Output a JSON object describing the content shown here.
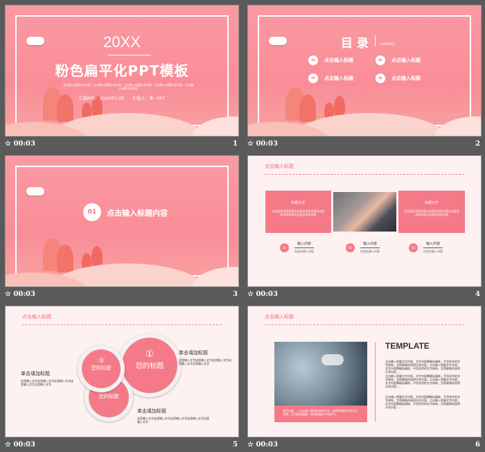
{
  "timing": "00:03",
  "star_icon": "star-outline-icon",
  "slides": [
    {
      "number": "1",
      "year": "20XX",
      "title": "粉色扁平化PPT模板",
      "subtitle": "点击输入标题文本内容，点击输入标题文本内容，点击输入标题文本内容，点击输入标题文本内容，点击输入标题文本内容",
      "meta": "汇报时间：20XX年12月　　汇报人：第一PPT"
    },
    {
      "number": "2",
      "title": "目 录",
      "title_en": "CONTENTS",
      "items": [
        {
          "num": "01",
          "label": "点击输入标题"
        },
        {
          "num": "02",
          "label": "点击输入标题"
        },
        {
          "num": "03",
          "label": "点击输入标题"
        },
        {
          "num": "04",
          "label": "点击输入标题"
        }
      ]
    },
    {
      "number": "3",
      "num": "01",
      "title": "点击输入标题内容"
    },
    {
      "number": "4",
      "header": "点击输入标题",
      "box_title": "标题文字",
      "box_text": "点击此处添加内容点击此处添加内容点击此处添加内容点击此处添加内容",
      "items": [
        {
          "num": "01",
          "label": "输入内容",
          "sub": "在此处输入内容"
        },
        {
          "num": "02",
          "label": "输入内容",
          "sub": "在此处输入内容"
        },
        {
          "num": "03",
          "label": "输入内容",
          "sub": "在此处输入内容"
        }
      ]
    },
    {
      "number": "5",
      "header": "点击输入标题",
      "circles": [
        {
          "num": "①",
          "label": "您的标题"
        },
        {
          "num": "②",
          "label": "您的标题"
        },
        {
          "num": "③",
          "label": "您的标题"
        }
      ],
      "blocks": [
        {
          "title": "单击填加标题",
          "text": "这里输入文字这里输入文字这里输入文字这里输入文字这里输入文字"
        },
        {
          "title": "单击填加标题",
          "text": "这里输入文字这里输入文字这里输入文字这里输入文字这里输入文字"
        },
        {
          "title": "单击填加标题",
          "text": "这里输入文字这里输入文字这里输入文字这里输入文字这里输入文字"
        }
      ]
    },
    {
      "number": "6",
      "header": "点击输入标题",
      "heading": "TEMPLATE",
      "caption": "填写内容……点击输入简短的具体文字，说明你要的内容分点内容，主为概念图解，简明扼要的介绍即可。",
      "paras": [
        "点击输入简要文字内容，文字内容需概括精炼，不用多余的文字修饰，言简意赅的说明分项内容。点击输入简要文字内容，文字内容需概括精炼，不用多余的文字修饰，言简意赅的说明分项内容……",
        "点击输入简要文字内容，文字内容需概括精炼，不用多余的文字修饰，言简意赅的说明分项内容。点击输入简要文字内容，文字内容需概括精炼，不用多余的文字修饰，言简意赅的说明分项内容……",
        "点击输入简要文字内容，文字内容需概括精炼，不用多余的文字修饰，言简意赅的说明分项内容。点击输入简要文字内容，文字内容需概括精炼，不用多余的文字修饰，言简意赅的说明分项内容……"
      ]
    }
  ]
}
